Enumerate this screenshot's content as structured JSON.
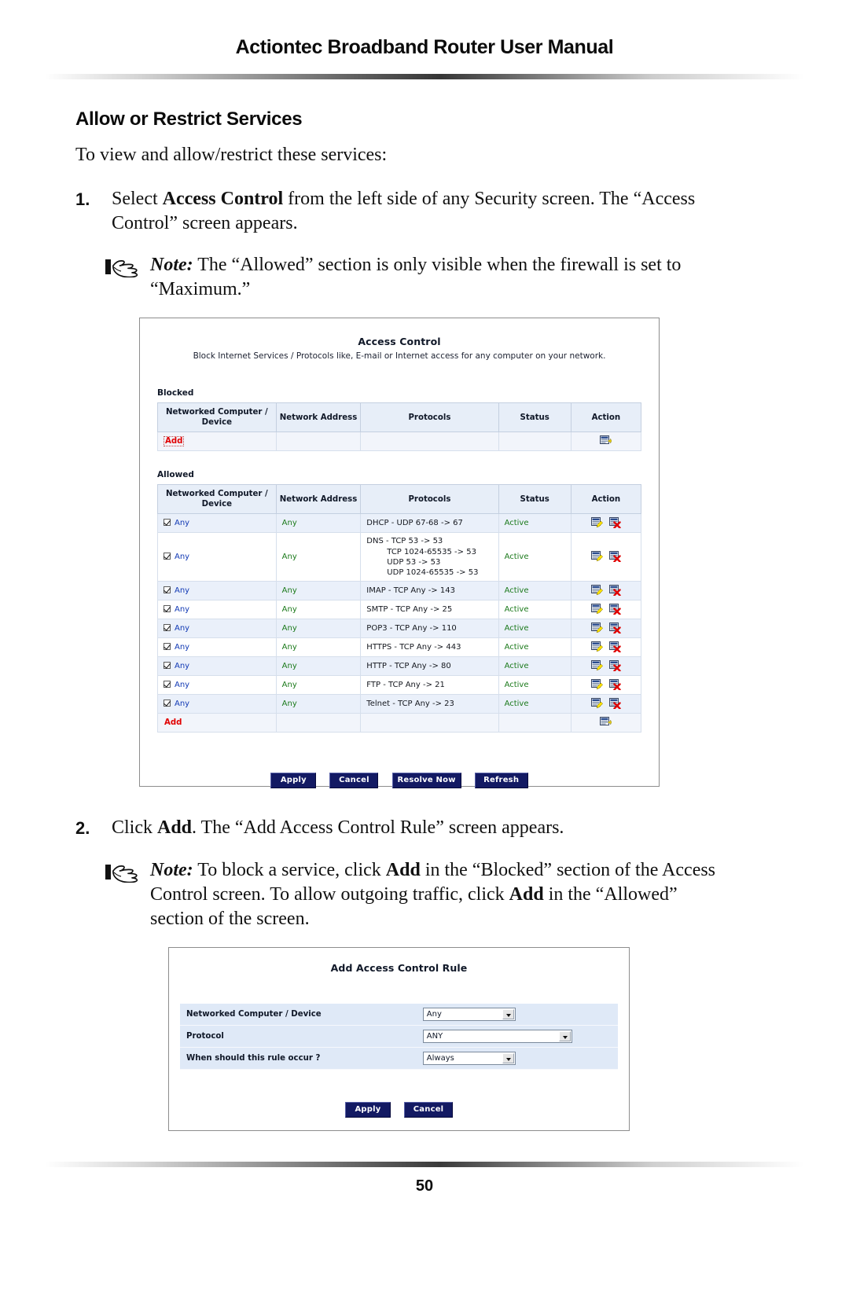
{
  "header": {
    "title": "Actiontec Broadband Router User Manual"
  },
  "footer": {
    "page_number": "50"
  },
  "section": {
    "title": "Allow or Restrict Services",
    "lead": "To view and allow/restrict these services:"
  },
  "steps": [
    {
      "number": "1.",
      "text_before": "Select ",
      "bold": "Access Control",
      "text_after": " from the left side of any Security screen. The “Access Control” screen appears."
    },
    {
      "number": "2.",
      "text_before": "Click ",
      "bold": "Add",
      "text_after": ". The “Add Access Control Rule” screen appears."
    }
  ],
  "notes": [
    {
      "label": "Note:",
      "icon": "pointing-hand-icon",
      "text": " The “Allowed” section is only visible when the firewall is set to “Maximum.”"
    },
    {
      "label": "Note:",
      "icon": "pointing-hand-icon",
      "part1": " To block a service, click ",
      "bold1": "Add",
      "part2": " in the “Blocked” section of the Access Control screen. To allow outgoing traffic, click ",
      "bold2": "Add",
      "part3": " in the “Allowed” section of the screen."
    }
  ],
  "access_control_screen": {
    "title": "Access Control",
    "subtitle": "Block Internet Services / Protocols like, E-mail or Internet access for any computer on your network.",
    "columns": [
      "Networked Computer / Device",
      "Network Address",
      "Protocols",
      "Status",
      "Action"
    ],
    "blocked": {
      "label": "Blocked",
      "rows": [],
      "add_label": "Add",
      "add_icon": "add-rule-icon"
    },
    "allowed": {
      "label": "Allowed",
      "rows": [
        {
          "device": "Any",
          "address": "Any",
          "protocol": "DHCP - UDP 67-68 -> 67",
          "protocol_extra": [],
          "status": "Active"
        },
        {
          "device": "Any",
          "address": "Any",
          "protocol": "DNS - TCP 53 -> 53",
          "protocol_extra": [
            "TCP 1024-65535 -> 53",
            "UDP 53 -> 53",
            "UDP 1024-65535 -> 53"
          ],
          "status": "Active"
        },
        {
          "device": "Any",
          "address": "Any",
          "protocol": "IMAP - TCP Any -> 143",
          "protocol_extra": [],
          "status": "Active"
        },
        {
          "device": "Any",
          "address": "Any",
          "protocol": "SMTP - TCP Any -> 25",
          "protocol_extra": [],
          "status": "Active"
        },
        {
          "device": "Any",
          "address": "Any",
          "protocol": "POP3 - TCP Any -> 110",
          "protocol_extra": [],
          "status": "Active"
        },
        {
          "device": "Any",
          "address": "Any",
          "protocol": "HTTPS - TCP Any -> 443",
          "protocol_extra": [],
          "status": "Active"
        },
        {
          "device": "Any",
          "address": "Any",
          "protocol": "HTTP - TCP Any -> 80",
          "protocol_extra": [],
          "status": "Active"
        },
        {
          "device": "Any",
          "address": "Any",
          "protocol": "FTP - TCP Any -> 21",
          "protocol_extra": [],
          "status": "Active"
        },
        {
          "device": "Any",
          "address": "Any",
          "protocol": "Telnet - TCP Any -> 23",
          "protocol_extra": [],
          "status": "Active"
        }
      ],
      "add_label": "Add",
      "add_icon": "add-rule-icon",
      "row_icons": [
        "edit-rule-icon",
        "delete-rule-icon"
      ]
    },
    "buttons": [
      "Apply",
      "Cancel",
      "Resolve Now",
      "Refresh"
    ]
  },
  "add_rule_screen": {
    "title": "Add Access Control Rule",
    "fields": [
      {
        "label": "Networked Computer / Device",
        "value": "Any"
      },
      {
        "label": "Protocol",
        "value": "ANY"
      },
      {
        "label": "When should this rule occur ?",
        "value": "Always"
      }
    ],
    "buttons": [
      "Apply",
      "Cancel"
    ]
  },
  "colors": {
    "link_blue": "#1139b4",
    "status_green": "#1c7a1c",
    "add_red": "#e10000",
    "button_navy": "#131a63",
    "table_header_bg": "#e7eef8",
    "row_stripe_bg": "#eaf0fa"
  }
}
